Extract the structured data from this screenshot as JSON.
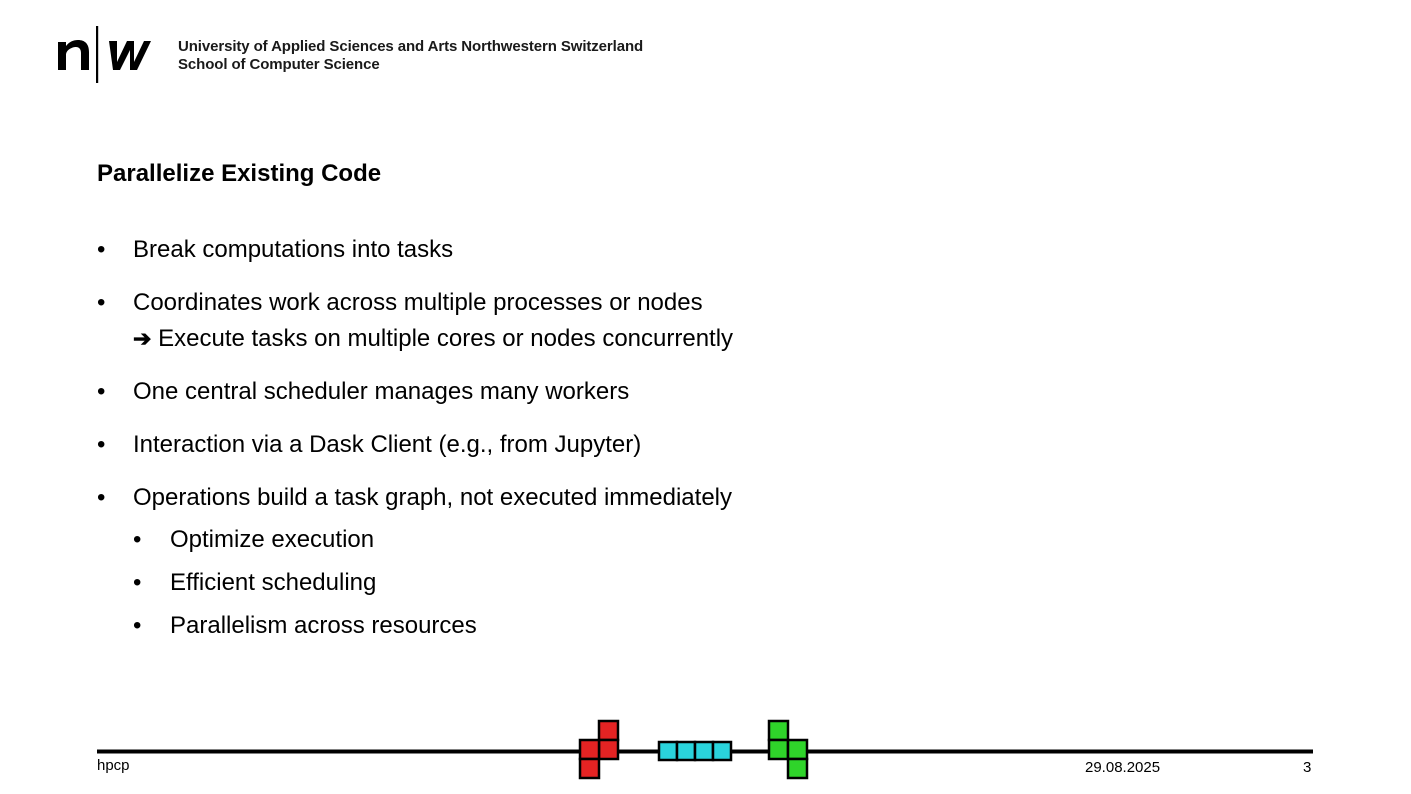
{
  "header": {
    "institution": "University of Applied Sciences and Arts Northwestern Switzerland",
    "school": "School of Computer Science"
  },
  "slide": {
    "title": "Parallelize Existing Code",
    "bullets": [
      {
        "text": "Break computations into tasks"
      },
      {
        "text": "Coordinates work across multiple processes or nodes",
        "arrow_text": "Execute tasks on multiple cores or nodes concurrently"
      },
      {
        "text": "One central scheduler manages many workers"
      },
      {
        "text": "Interaction via a Dask Client (e.g., from Jupyter)"
      },
      {
        "text": "Operations build a task graph, not executed immediately",
        "sub": [
          {
            "text": "Optimize execution"
          },
          {
            "text": "Efficient scheduling"
          },
          {
            "text": "Parallelism across resources"
          }
        ]
      }
    ]
  },
  "footer": {
    "left": "hpcp",
    "date": "29.08.2025",
    "page": "3"
  },
  "colors": {
    "tetromino_red": "#e42323",
    "tetromino_cyan": "#2ad4dc",
    "tetromino_green": "#2fd42a"
  }
}
